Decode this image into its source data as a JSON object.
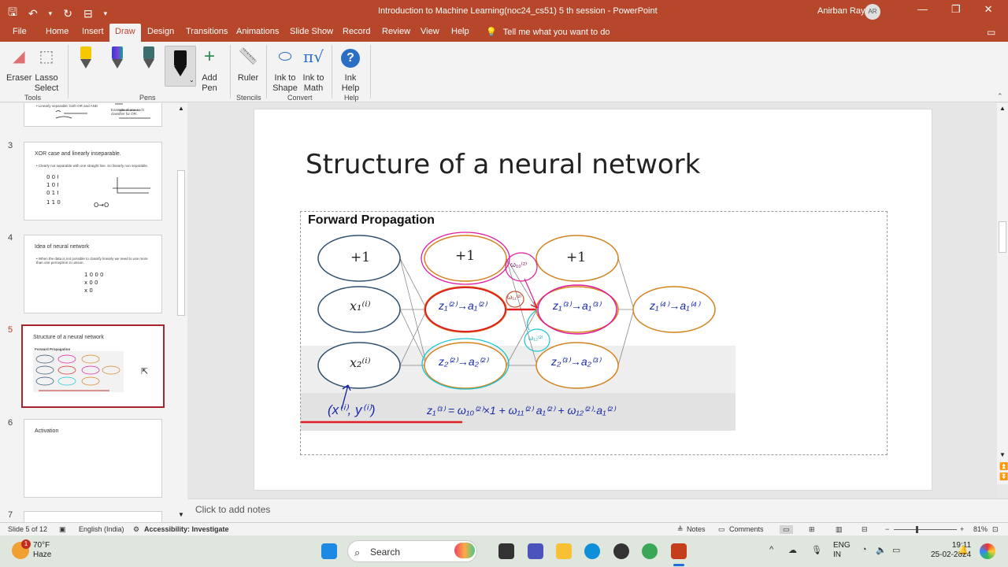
{
  "window": {
    "doc_title": "Introduction to Machine Learning(noc24_cs51) 5 th session  -  PowerPoint",
    "user": "Anirban Ray",
    "initials": "AR"
  },
  "qat": {
    "save": "🖫",
    "undo": "↶",
    "undo_dd": "▾",
    "redo": "↻",
    "present": "⊟",
    "customize": "▾"
  },
  "window_controls": {
    "minimize": "—",
    "restore": "❐",
    "close": "✕"
  },
  "tabs": [
    "File",
    "Home",
    "Insert",
    "Draw",
    "Design",
    "Transitions",
    "Animations",
    "Slide Show",
    "Record",
    "Review",
    "View",
    "Help"
  ],
  "tell_me": {
    "icon": "💡",
    "text": "Tell me what you want to do"
  },
  "ribbon": {
    "eraser": "Eraser",
    "lasso": "Lasso\nSelect",
    "add_pen": "Add\nPen",
    "ruler": "Ruler",
    "ink_shape": "Ink to\nShape",
    "ink_math": "Ink to\nMath",
    "ink_help": "Ink\nHelp",
    "groups": {
      "tools": "Tools",
      "pens": "Pens",
      "stencils": "Stencils",
      "convert": "Convert",
      "help": "Help"
    },
    "icons": {
      "eraser": "◢",
      "lasso": "⬚",
      "add": "+",
      "ruler": "📏",
      "shape": "⬭",
      "math": "π√",
      "help": "?"
    }
  },
  "slides": [
    {
      "num": "3",
      "title": "XOR case and linearly inseparable.",
      "text": "• Clearly not separable with one straight line. So linearly non separable."
    },
    {
      "num": "4",
      "title": "Idea of neural network",
      "text": "• When the data is not possible to classify linearly we need to use more than one perceptron in unison."
    },
    {
      "num": "5",
      "title": "Structure of a neural network",
      "text": "Forward Propagation"
    },
    {
      "num": "6",
      "title": "Activation",
      "text": ""
    },
    {
      "num": "7",
      "title": "",
      "text": ""
    }
  ],
  "slide2_partial": {
    "bullet": "• Linearly separable: both OR and AND",
    "example": "Example of one such classifier for OR:"
  },
  "main_slide": {
    "title": "Structure of a neural network",
    "fp_title": "Forward Propagation"
  },
  "diagram": {
    "input_bias": "+1",
    "x1": "x₁⁽ⁱ⁾",
    "x2": "x₂⁽ⁱ⁾",
    "hidden_bias": "+1",
    "z21": "z₁⁽²⁾→a₁⁽²⁾",
    "z22": "z₂⁽²⁾→a₂⁽²⁾",
    "hidden2_bias": "+1",
    "z31": "z₁⁽³⁾→a₁⁽³⁾",
    "z32": "z₂⁽³⁾→a₂⁽³⁾",
    "output": "z₁⁽⁴⁾→a₁⁽⁴⁾",
    "pair": "(x⁽ⁱ⁾, y⁽ⁱ⁾)",
    "equation": "z₁⁽³⁾ = ω₁₀⁽²⁾×1 + ω₁₁⁽²⁾ a₁⁽²⁾ + ω₁₂⁽²⁾·a₁⁽²⁾",
    "w10": "ω₁₀⁽²⁾",
    "w11": "ω₁₁⁽²⁾",
    "w12": "ω₁₂⁽²⁾"
  },
  "notes": "Click to add notes",
  "status": {
    "slide": "Slide 5 of 12",
    "lang": "English (India)",
    "access": "Accessibility: Investigate",
    "notes": "Notes",
    "comments": "Comments",
    "zoom": "81%",
    "zoom_minus": "−",
    "zoom_plus": "+"
  },
  "taskbar": {
    "temp": "70°F",
    "weather": "Haze",
    "search": "Search",
    "lang1": "ENG",
    "lang2": "IN",
    "time": "19:11",
    "date": "25-02-2024",
    "chevron": "^",
    "badge": "1"
  },
  "colors": {
    "accent": "#b7472a",
    "selected_border": "#a4262c"
  }
}
